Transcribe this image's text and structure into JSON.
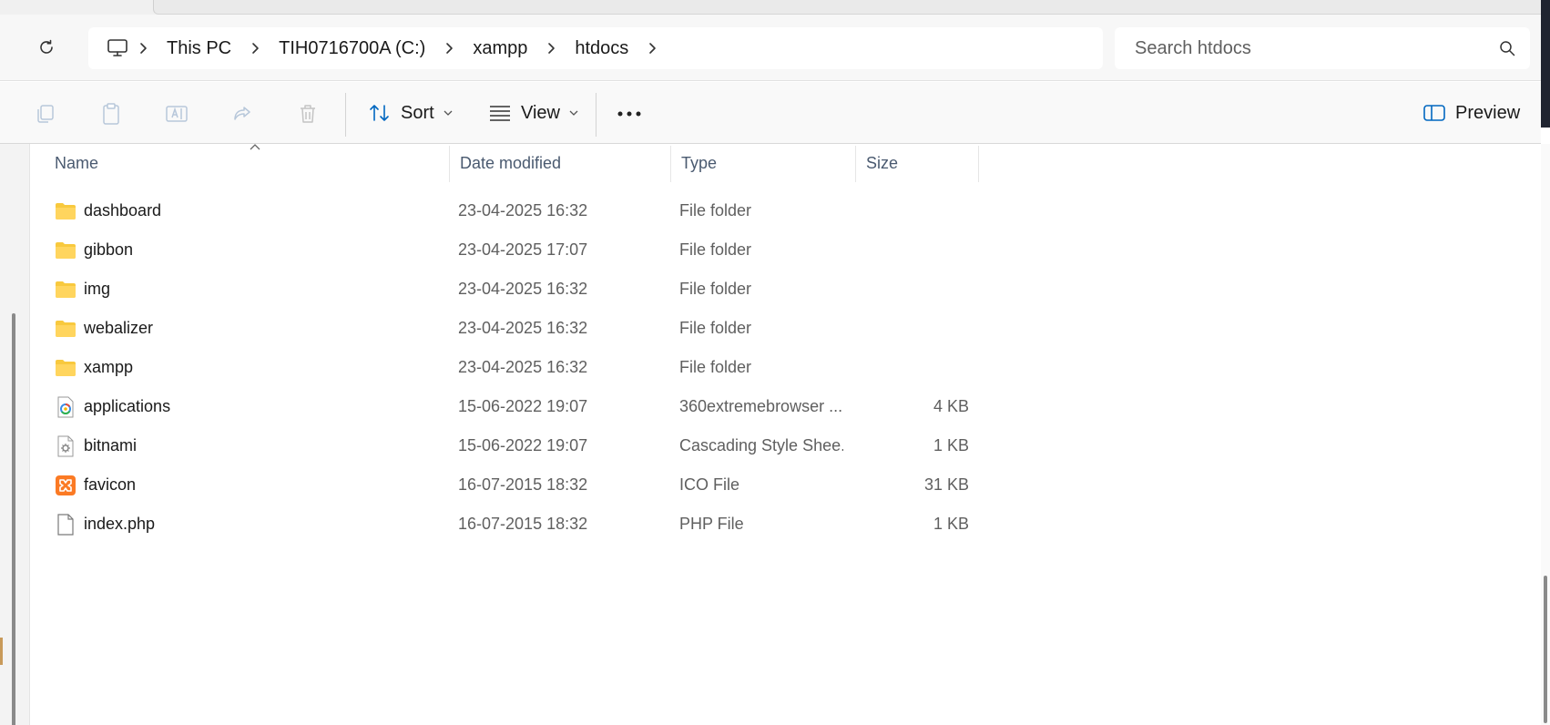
{
  "breadcrumb": {
    "items": [
      "This PC",
      "TIH0716700A (C:)",
      "xampp",
      "htdocs"
    ]
  },
  "search": {
    "placeholder": "Search htdocs"
  },
  "commandbar": {
    "sort_label": "Sort",
    "view_label": "View",
    "preview_label": "Preview"
  },
  "columns": {
    "name": "Name",
    "date": "Date modified",
    "type": "Type",
    "size": "Size"
  },
  "files": [
    {
      "name": "dashboard",
      "date": "23-04-2025 16:32",
      "type": "File folder",
      "size": "",
      "icon": "folder-icon"
    },
    {
      "name": "gibbon",
      "date": "23-04-2025 17:07",
      "type": "File folder",
      "size": "",
      "icon": "folder-icon"
    },
    {
      "name": "img",
      "date": "23-04-2025 16:32",
      "type": "File folder",
      "size": "",
      "icon": "folder-icon"
    },
    {
      "name": "webalizer",
      "date": "23-04-2025 16:32",
      "type": "File folder",
      "size": "",
      "icon": "folder-icon"
    },
    {
      "name": "xampp",
      "date": "23-04-2025 16:32",
      "type": "File folder",
      "size": "",
      "icon": "folder-icon"
    },
    {
      "name": "applications",
      "date": "15-06-2022 19:07",
      "type": "360extremebrowser ...",
      "size": "4 KB",
      "icon": "html-file-icon"
    },
    {
      "name": "bitnami",
      "date": "15-06-2022 19:07",
      "type": "Cascading Style Shee...",
      "size": "1 KB",
      "icon": "css-file-icon"
    },
    {
      "name": "favicon",
      "date": "16-07-2015 18:32",
      "type": "ICO File",
      "size": "31 KB",
      "icon": "xampp-ico-icon"
    },
    {
      "name": "index.php",
      "date": "16-07-2015 18:32",
      "type": "PHP File",
      "size": "1 KB",
      "icon": "blank-file-icon"
    }
  ],
  "colors": {
    "folder": "#f8c93e",
    "accent": "#0067c0",
    "xampp": "#fb7a24"
  }
}
